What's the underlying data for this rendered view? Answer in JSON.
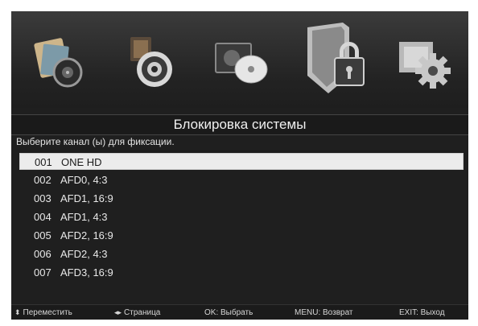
{
  "menu": {
    "icons": [
      {
        "name": "picture-icon",
        "selected": false
      },
      {
        "name": "audio-icon",
        "selected": false
      },
      {
        "name": "disc-icon",
        "selected": false
      },
      {
        "name": "lock-icon",
        "selected": true
      },
      {
        "name": "settings-icon",
        "selected": false
      }
    ]
  },
  "header": {
    "title": "Блокировка системы",
    "subtitle": "Выберите канал (ы) для фиксации."
  },
  "channels": [
    {
      "num": "001",
      "name": "ONE HD",
      "selected": true
    },
    {
      "num": "002",
      "name": "AFD0, 4:3",
      "selected": false
    },
    {
      "num": "003",
      "name": "AFD1, 16:9",
      "selected": false
    },
    {
      "num": "004",
      "name": "AFD1, 4:3",
      "selected": false
    },
    {
      "num": "005",
      "name": "AFD2, 16:9",
      "selected": false
    },
    {
      "num": "006",
      "name": "AFD2, 4:3",
      "selected": false
    },
    {
      "num": "007",
      "name": "AFD3, 16:9",
      "selected": false
    }
  ],
  "help": {
    "move_icon": "up-down-arrows-icon",
    "move": "Переместить",
    "page_icon": "left-right-arrows-icon",
    "page": "Страница",
    "ok": "OK: Выбрать",
    "menu": "MENU:  Возврат",
    "exit": "EXIT: Выход"
  },
  "colors": {
    "background": "#1f1f1f",
    "highlight": "#ececec",
    "text": "#e8e8e8"
  }
}
